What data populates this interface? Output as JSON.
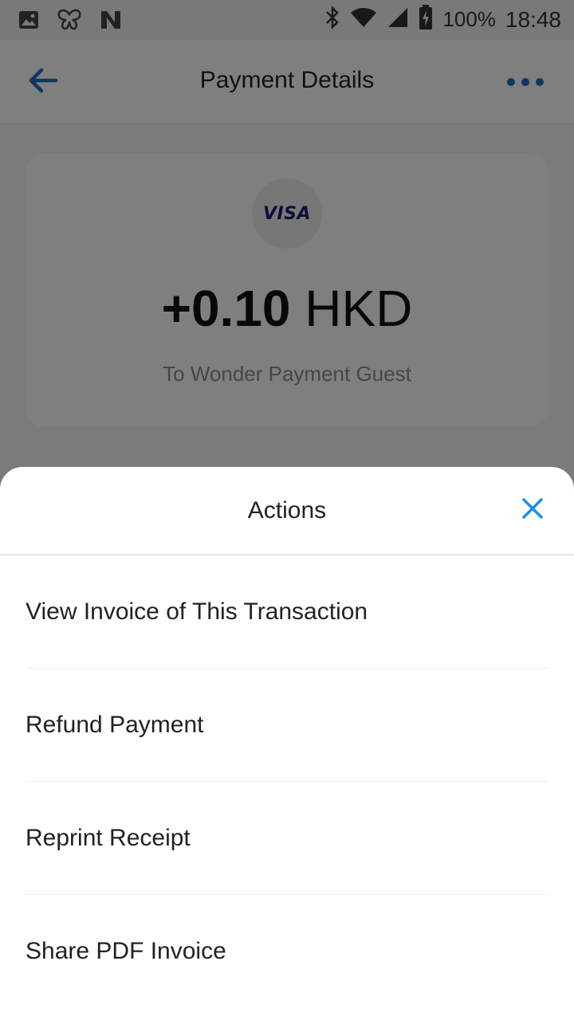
{
  "status_bar": {
    "left_icons": [
      "gallery-icon",
      "butterfly-icon",
      "n-app-icon"
    ],
    "right_icons": [
      "bluetooth-icon",
      "wifi-icon",
      "signal-icon",
      "battery-icon"
    ],
    "battery": "100%",
    "time": "18:48"
  },
  "app_bar": {
    "title": "Payment Details",
    "back_icon": "arrow-left-icon",
    "more_icon": "more-horizontal-icon"
  },
  "payment": {
    "card_brand": "VISA",
    "amount_value": "+0.10",
    "amount_currency": "HKD",
    "recipient": "To Wonder Payment Guest"
  },
  "sheet": {
    "title": "Actions",
    "close_icon": "close-icon",
    "actions": [
      {
        "label": "View Invoice of This Transaction"
      },
      {
        "label": "Refund Payment"
      },
      {
        "label": "Reprint Receipt"
      },
      {
        "label": "Share PDF Invoice"
      }
    ]
  },
  "colors": {
    "accent": "#1e6fc6",
    "close": "#1a8fe3",
    "visa": "#1a1f71",
    "overlay": "rgba(0,0,0,0.5)"
  }
}
